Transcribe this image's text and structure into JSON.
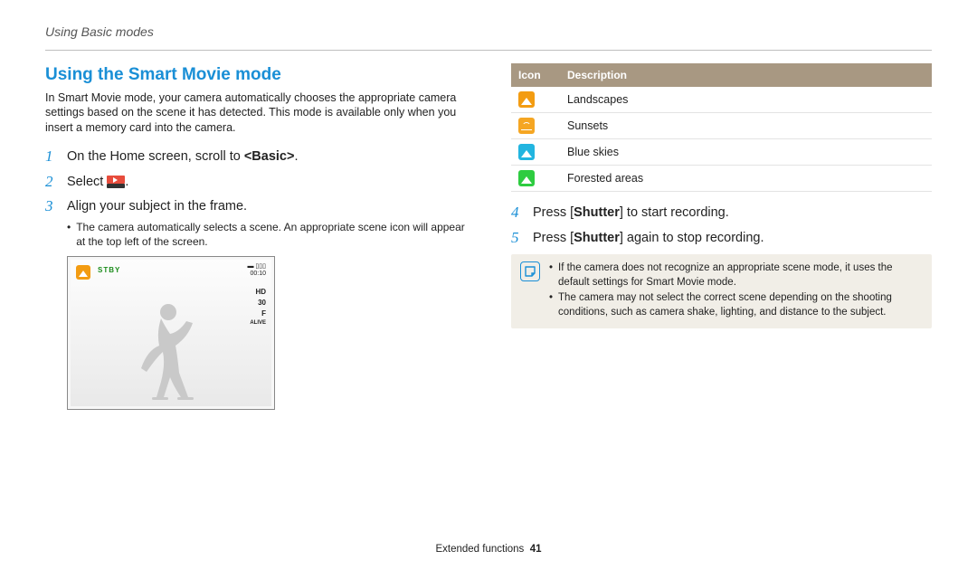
{
  "header": {
    "section": "Using Basic modes"
  },
  "title": "Using the Smart Movie mode",
  "intro": "In Smart Movie mode, your camera automatically chooses the appropriate camera settings based on the scene it has detected. This mode is available only when you insert a memory card into the camera.",
  "steps": {
    "s1": {
      "num": "1",
      "pre": "On the Home screen, scroll to ",
      "bold": "<Basic>",
      "post": "."
    },
    "s2": {
      "num": "2",
      "pre": "Select ",
      "post": "."
    },
    "s3": {
      "num": "3",
      "text": "Align your subject in the frame.",
      "sub": "The camera automatically selects a scene. An appropriate scene icon will appear at the top left of the screen."
    },
    "s4": {
      "num": "4",
      "pre": "Press [",
      "bold": "Shutter",
      "post": "] to start recording."
    },
    "s5": {
      "num": "5",
      "pre": "Press [",
      "bold": "Shutter",
      "post": "] again to stop recording."
    }
  },
  "camera": {
    "stby": "STBY",
    "time": "00:10",
    "right": {
      "hd": "HD",
      "fps": "30",
      "f": "F",
      "alive": "ALIVE"
    }
  },
  "table": {
    "head": {
      "icon": "Icon",
      "desc": "Description"
    },
    "rows": [
      {
        "desc": "Landscapes"
      },
      {
        "desc": "Sunsets"
      },
      {
        "desc": "Blue skies"
      },
      {
        "desc": "Forested areas"
      }
    ]
  },
  "notes": {
    "n1": "If the camera does not recognize an appropriate scene mode, it uses the default settings for Smart Movie mode.",
    "n2": "The camera may not select the correct scene depending on the shooting conditions, such as camera shake, lighting, and distance to the subject."
  },
  "footer": {
    "label": "Extended functions",
    "page": "41"
  }
}
